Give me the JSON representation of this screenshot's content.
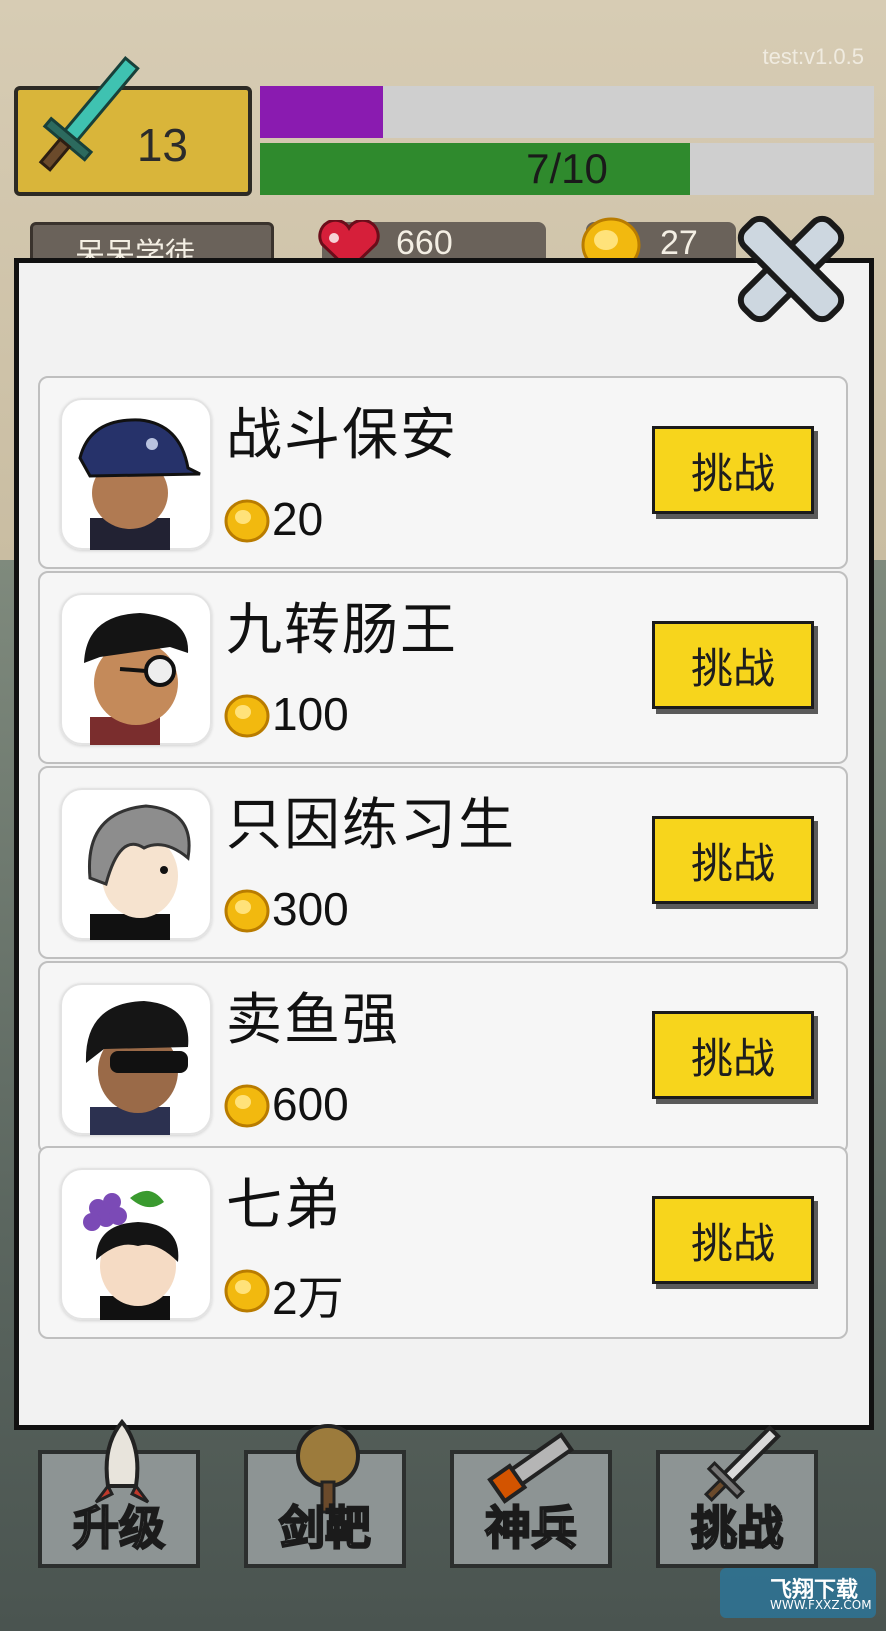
{
  "version": "test:v1.0.5",
  "player": {
    "level": "13",
    "xp_fraction": 0.2,
    "hp_text": "7/10",
    "hp_fraction": 0.7,
    "title": "呆呆学徒",
    "hearts": "660",
    "coins": "27"
  },
  "colors": {
    "button_yellow": "#f7d51c",
    "xp_purple": "#8a1bb0",
    "hp_green": "#2f8a2d"
  },
  "opponents": [
    {
      "name": "战斗保安",
      "cost": "20",
      "button": "挑战",
      "avatar": "security-guard"
    },
    {
      "name": "九转肠王",
      "cost": "100",
      "button": "挑战",
      "avatar": "glasses-man"
    },
    {
      "name": "只因练习生",
      "cost": "300",
      "button": "挑战",
      "avatar": "gray-hair-man"
    },
    {
      "name": "卖鱼强",
      "cost": "600",
      "button": "挑战",
      "avatar": "sunglasses-man"
    },
    {
      "name": "七弟",
      "cost": "2万",
      "button": "挑战",
      "avatar": "grape-kid"
    }
  ],
  "tabs": [
    {
      "label": "升级",
      "icon": "rocket-icon"
    },
    {
      "label": "剑靶",
      "icon": "target-dummy-icon"
    },
    {
      "label": "神兵",
      "icon": "chainsaw-icon"
    },
    {
      "label": "挑战",
      "icon": "sword-icon"
    }
  ],
  "watermark": {
    "brand": "飞翔下载",
    "url": "WWW.FXXZ.COM"
  }
}
